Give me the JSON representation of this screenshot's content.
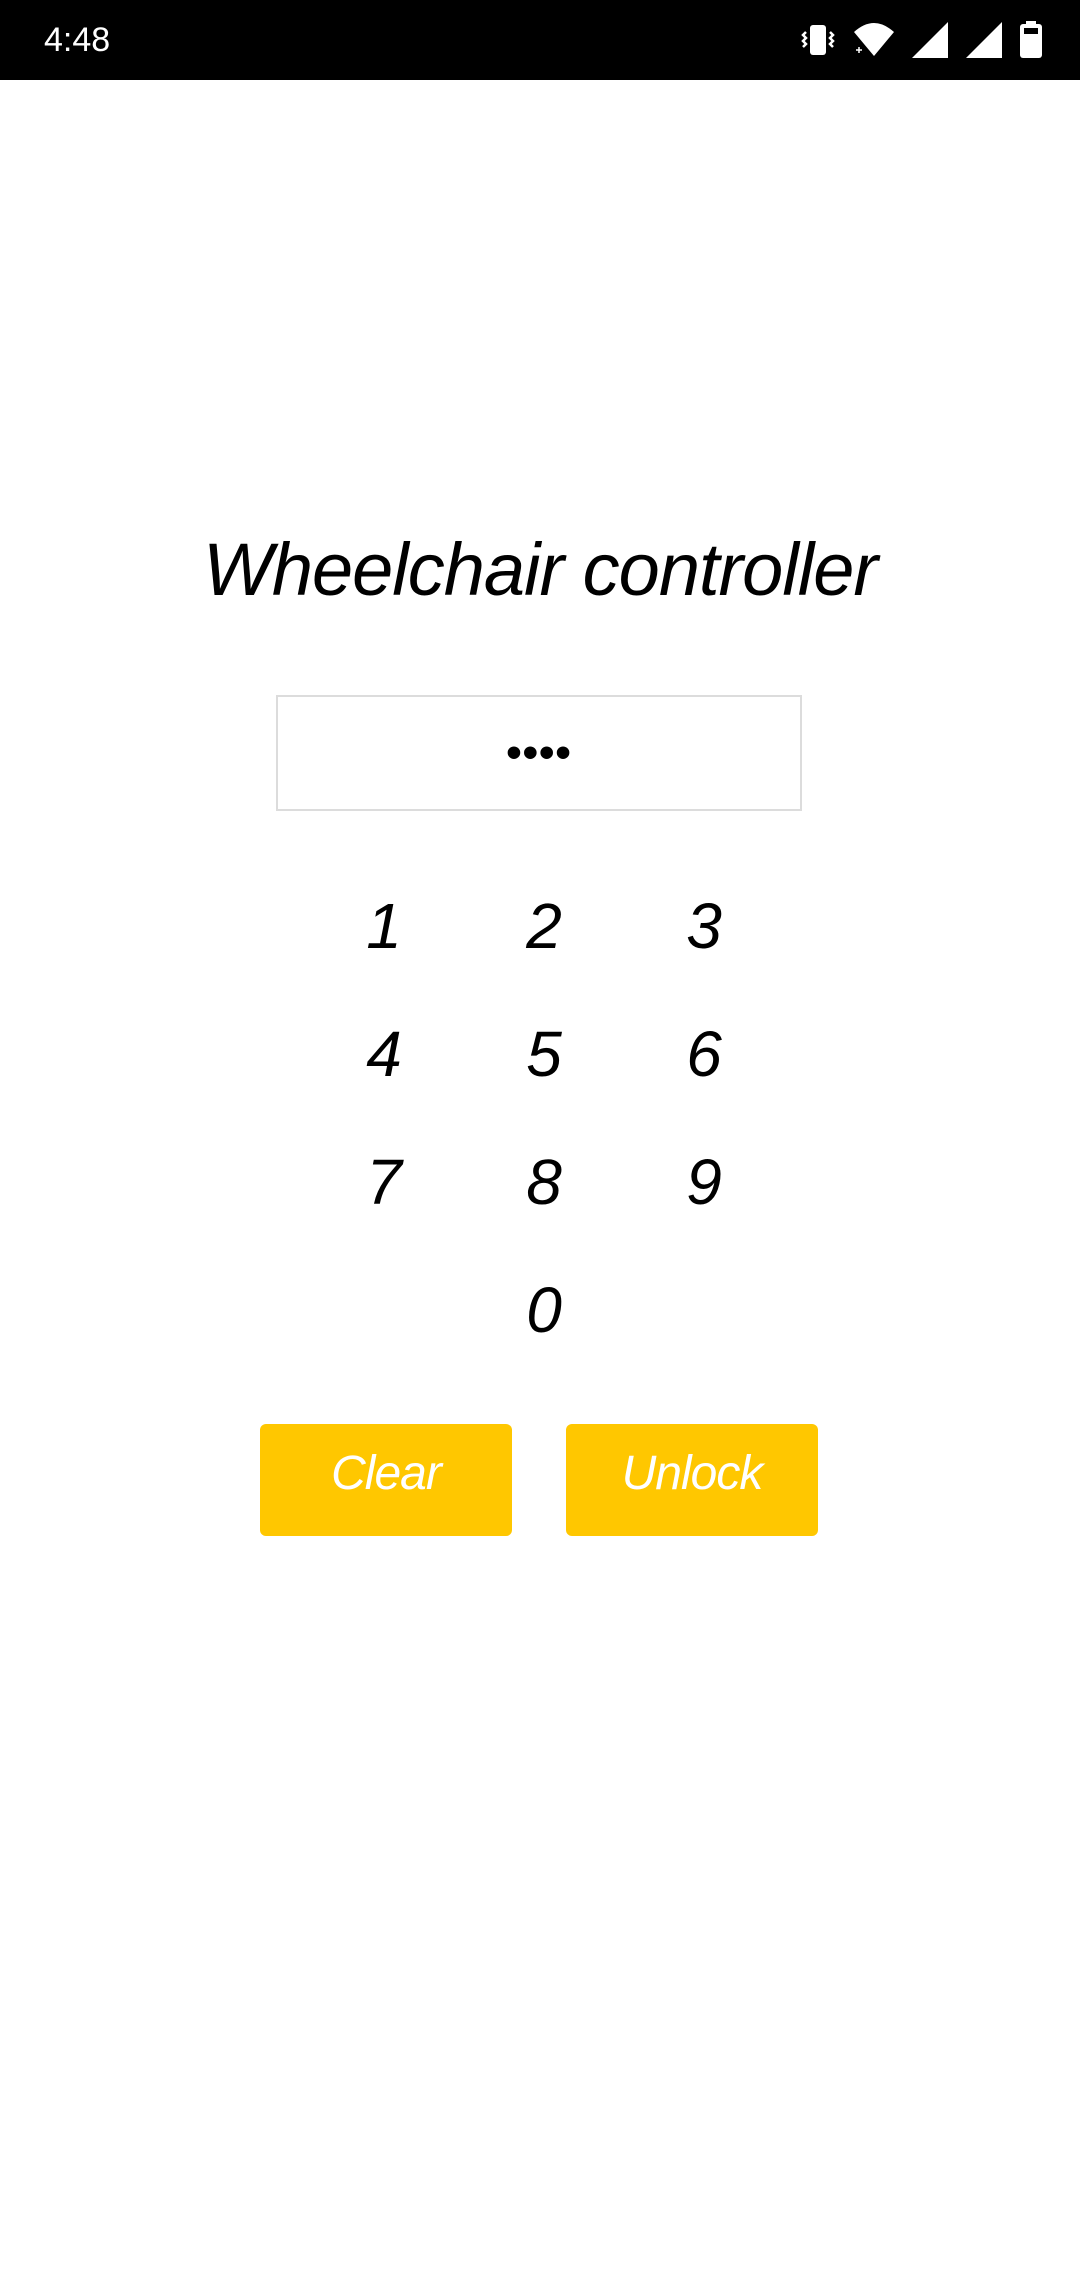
{
  "status_bar": {
    "time": "4:48",
    "icons": [
      "vibrate-icon",
      "wifi-icon",
      "signal-icon",
      "signal-icon",
      "battery-icon"
    ]
  },
  "app": {
    "title": "Wheelchair controller"
  },
  "pin_field": {
    "value": "••••"
  },
  "keypad": {
    "keys": [
      "1",
      "2",
      "3",
      "4",
      "5",
      "6",
      "7",
      "8",
      "9",
      "0"
    ]
  },
  "actions": {
    "clear_label": "Clear",
    "unlock_label": "Unlock"
  },
  "colors": {
    "accent": "#ffc700",
    "status_bar_bg": "#000000",
    "background": "#ffffff"
  }
}
